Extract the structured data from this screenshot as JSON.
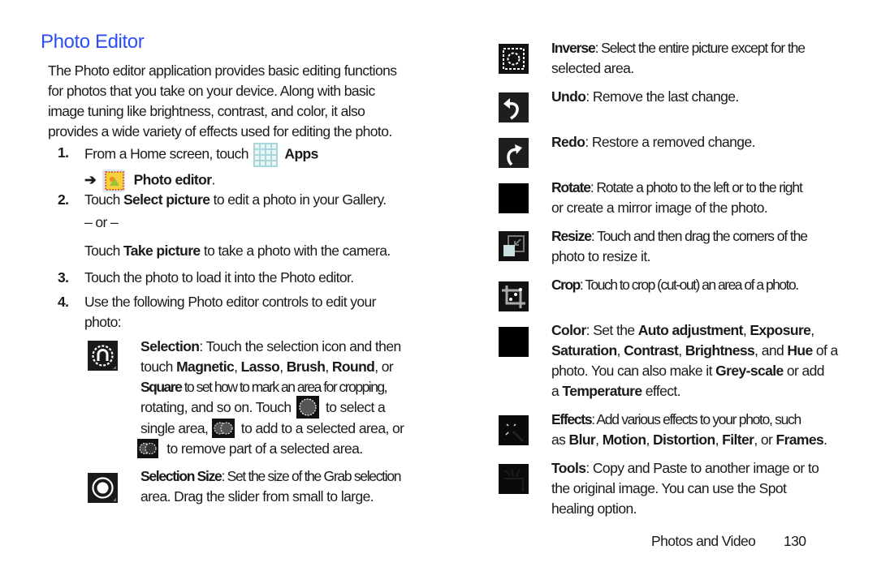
{
  "page": {
    "title": "Photo Editor",
    "intro_lines": [
      "The Photo editor application provides basic editing functions",
      "for photos that you take on your device. Along with basic",
      "image tuning like brightness, contrast, and color, it also",
      "provides a wide variety of effects used for editing the photo."
    ],
    "accent_color": "#2d4ef0"
  },
  "steps": [
    {
      "num": "1.",
      "line1_pre": "From a Home screen, touch ",
      "line1_icon": "apps-grid-icon",
      "line1_bold": "Apps",
      "line2_arrow": "➔",
      "line2_icon": "photo-editor-app-icon",
      "line2_bold": "Photo editor",
      "line2_post": "."
    },
    {
      "num": "2.",
      "pre": "Touch ",
      "bold": "Select picture",
      "post": " to edit a photo in your Gallery.",
      "or": "– or –",
      "alt_pre": "Touch ",
      "alt_bold": "Take picture",
      "alt_post": " to take a photo with the camera."
    },
    {
      "num": "3.",
      "text": "Touch the photo to load it into the Photo editor."
    },
    {
      "num": "4.",
      "line1": "Use the following Photo editor controls to edit your",
      "line2": "photo:"
    }
  ],
  "left_controls": [
    {
      "icon": "selection-magnet-icon",
      "label": "Selection",
      "lines": [
        ": Touch the selection icon and then",
        "touch ",
        "Magnetic",
        ", ",
        "Lasso",
        ", ",
        "Brush",
        ", ",
        "Round",
        ", or",
        "Square",
        " to set how to mark an area for cropping,",
        "rotating, and so on. Touch ",
        " to select a",
        "single area, ",
        " to add to a selected area, or",
        " to remove part of a selected area."
      ]
    },
    {
      "icon": "selection-size-icon",
      "label": "Selection Size",
      "line1": ": Set the size of the Grab selection",
      "line2": "area. Drag the slider from small to large."
    }
  ],
  "right_controls": [
    {
      "icon": "inverse-icon",
      "label": "Inverse",
      "lines": [
        ": Select the entire picture except for the",
        "selected area."
      ]
    },
    {
      "icon": "undo-icon",
      "label": "Undo",
      "lines": [
        ": Remove the last change."
      ]
    },
    {
      "icon": "redo-icon",
      "label": "Redo",
      "lines": [
        ": Restore a removed change."
      ]
    },
    {
      "icon": "rotate-icon",
      "label": "Rotate",
      "lines": [
        ": Rotate a photo to the left or to the right",
        "or create a mirror image of the photo."
      ]
    },
    {
      "icon": "resize-icon",
      "label": "Resize",
      "lines": [
        ": Touch and then drag the corners of the",
        "photo to resize it."
      ]
    },
    {
      "icon": "crop-icon",
      "label": "Crop",
      "lines": [
        ": Touch to crop (cut-out) an area of a photo."
      ]
    },
    {
      "icon": "color-icon",
      "label": "Color",
      "segments": [
        {
          "t": ": Set the ",
          "b": false
        },
        {
          "t": "Auto adjustment",
          "b": true
        },
        {
          "t": ", ",
          "b": false
        },
        {
          "t": "Exposure",
          "b": true
        },
        {
          "t": ",",
          "b": false
        },
        {
          "t": "Saturation",
          "b": true
        },
        {
          "t": ", ",
          "b": false
        },
        {
          "t": "Contrast",
          "b": true
        },
        {
          "t": ", ",
          "b": false
        },
        {
          "t": "Brightness",
          "b": true
        },
        {
          "t": ", and ",
          "b": false
        },
        {
          "t": "Hue",
          "b": true
        },
        {
          "t": " of a",
          "b": false
        },
        {
          "t": "photo. You can also make it ",
          "b": false
        },
        {
          "t": "Grey-scale",
          "b": true
        },
        {
          "t": " or add",
          "b": false
        },
        {
          "t": "a ",
          "b": false
        },
        {
          "t": "Temperature",
          "b": true
        },
        {
          "t": " effect.",
          "b": false
        }
      ]
    },
    {
      "icon": "effects-icon",
      "label": "Effects",
      "segments": [
        {
          "t": ": Add various effects to your photo, such",
          "b": false
        },
        {
          "t": "as ",
          "b": false
        },
        {
          "t": "Blur",
          "b": true
        },
        {
          "t": ", ",
          "b": false
        },
        {
          "t": "Motion",
          "b": true
        },
        {
          "t": ", ",
          "b": false
        },
        {
          "t": "Distortion",
          "b": true
        },
        {
          "t": ", ",
          "b": false
        },
        {
          "t": "Filter",
          "b": true
        },
        {
          "t": ", or ",
          "b": false
        },
        {
          "t": "Frames",
          "b": true
        },
        {
          "t": ".",
          "b": false
        }
      ]
    },
    {
      "icon": "tools-icon",
      "label": "Tools",
      "lines": [
        ": Copy and Paste to another image or to",
        "the original image. You can use the Spot",
        "healing option."
      ]
    }
  ],
  "footer": {
    "section": "Photos and Video",
    "page_number": "130"
  }
}
